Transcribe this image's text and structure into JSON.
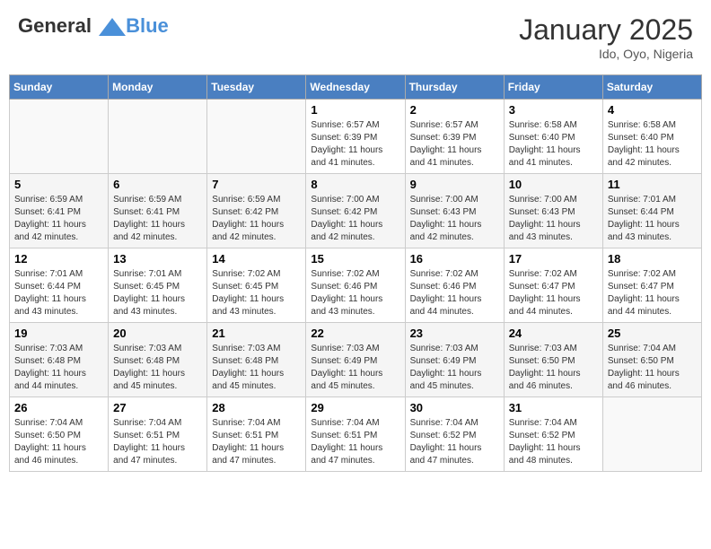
{
  "header": {
    "logo_line1": "General",
    "logo_line2": "Blue",
    "month_title": "January 2025",
    "location": "Ido, Oyo, Nigeria"
  },
  "days_of_week": [
    "Sunday",
    "Monday",
    "Tuesday",
    "Wednesday",
    "Thursday",
    "Friday",
    "Saturday"
  ],
  "weeks": [
    [
      {
        "day": "",
        "info": ""
      },
      {
        "day": "",
        "info": ""
      },
      {
        "day": "",
        "info": ""
      },
      {
        "day": "1",
        "info": "Sunrise: 6:57 AM\nSunset: 6:39 PM\nDaylight: 11 hours and 41 minutes."
      },
      {
        "day": "2",
        "info": "Sunrise: 6:57 AM\nSunset: 6:39 PM\nDaylight: 11 hours and 41 minutes."
      },
      {
        "day": "3",
        "info": "Sunrise: 6:58 AM\nSunset: 6:40 PM\nDaylight: 11 hours and 41 minutes."
      },
      {
        "day": "4",
        "info": "Sunrise: 6:58 AM\nSunset: 6:40 PM\nDaylight: 11 hours and 42 minutes."
      }
    ],
    [
      {
        "day": "5",
        "info": "Sunrise: 6:59 AM\nSunset: 6:41 PM\nDaylight: 11 hours and 42 minutes."
      },
      {
        "day": "6",
        "info": "Sunrise: 6:59 AM\nSunset: 6:41 PM\nDaylight: 11 hours and 42 minutes."
      },
      {
        "day": "7",
        "info": "Sunrise: 6:59 AM\nSunset: 6:42 PM\nDaylight: 11 hours and 42 minutes."
      },
      {
        "day": "8",
        "info": "Sunrise: 7:00 AM\nSunset: 6:42 PM\nDaylight: 11 hours and 42 minutes."
      },
      {
        "day": "9",
        "info": "Sunrise: 7:00 AM\nSunset: 6:43 PM\nDaylight: 11 hours and 42 minutes."
      },
      {
        "day": "10",
        "info": "Sunrise: 7:00 AM\nSunset: 6:43 PM\nDaylight: 11 hours and 43 minutes."
      },
      {
        "day": "11",
        "info": "Sunrise: 7:01 AM\nSunset: 6:44 PM\nDaylight: 11 hours and 43 minutes."
      }
    ],
    [
      {
        "day": "12",
        "info": "Sunrise: 7:01 AM\nSunset: 6:44 PM\nDaylight: 11 hours and 43 minutes."
      },
      {
        "day": "13",
        "info": "Sunrise: 7:01 AM\nSunset: 6:45 PM\nDaylight: 11 hours and 43 minutes."
      },
      {
        "day": "14",
        "info": "Sunrise: 7:02 AM\nSunset: 6:45 PM\nDaylight: 11 hours and 43 minutes."
      },
      {
        "day": "15",
        "info": "Sunrise: 7:02 AM\nSunset: 6:46 PM\nDaylight: 11 hours and 43 minutes."
      },
      {
        "day": "16",
        "info": "Sunrise: 7:02 AM\nSunset: 6:46 PM\nDaylight: 11 hours and 44 minutes."
      },
      {
        "day": "17",
        "info": "Sunrise: 7:02 AM\nSunset: 6:47 PM\nDaylight: 11 hours and 44 minutes."
      },
      {
        "day": "18",
        "info": "Sunrise: 7:02 AM\nSunset: 6:47 PM\nDaylight: 11 hours and 44 minutes."
      }
    ],
    [
      {
        "day": "19",
        "info": "Sunrise: 7:03 AM\nSunset: 6:48 PM\nDaylight: 11 hours and 44 minutes."
      },
      {
        "day": "20",
        "info": "Sunrise: 7:03 AM\nSunset: 6:48 PM\nDaylight: 11 hours and 45 minutes."
      },
      {
        "day": "21",
        "info": "Sunrise: 7:03 AM\nSunset: 6:48 PM\nDaylight: 11 hours and 45 minutes."
      },
      {
        "day": "22",
        "info": "Sunrise: 7:03 AM\nSunset: 6:49 PM\nDaylight: 11 hours and 45 minutes."
      },
      {
        "day": "23",
        "info": "Sunrise: 7:03 AM\nSunset: 6:49 PM\nDaylight: 11 hours and 45 minutes."
      },
      {
        "day": "24",
        "info": "Sunrise: 7:03 AM\nSunset: 6:50 PM\nDaylight: 11 hours and 46 minutes."
      },
      {
        "day": "25",
        "info": "Sunrise: 7:04 AM\nSunset: 6:50 PM\nDaylight: 11 hours and 46 minutes."
      }
    ],
    [
      {
        "day": "26",
        "info": "Sunrise: 7:04 AM\nSunset: 6:50 PM\nDaylight: 11 hours and 46 minutes."
      },
      {
        "day": "27",
        "info": "Sunrise: 7:04 AM\nSunset: 6:51 PM\nDaylight: 11 hours and 47 minutes."
      },
      {
        "day": "28",
        "info": "Sunrise: 7:04 AM\nSunset: 6:51 PM\nDaylight: 11 hours and 47 minutes."
      },
      {
        "day": "29",
        "info": "Sunrise: 7:04 AM\nSunset: 6:51 PM\nDaylight: 11 hours and 47 minutes."
      },
      {
        "day": "30",
        "info": "Sunrise: 7:04 AM\nSunset: 6:52 PM\nDaylight: 11 hours and 47 minutes."
      },
      {
        "day": "31",
        "info": "Sunrise: 7:04 AM\nSunset: 6:52 PM\nDaylight: 11 hours and 48 minutes."
      },
      {
        "day": "",
        "info": ""
      }
    ]
  ]
}
